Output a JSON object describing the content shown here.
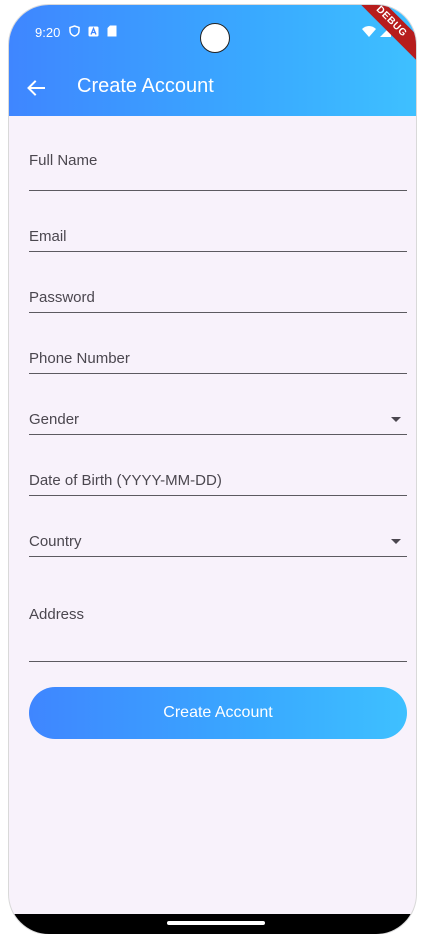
{
  "status_bar": {
    "time": "9:20",
    "icons": [
      "shield-icon",
      "a-icon",
      "sd-card-icon",
      "wifi-icon",
      "signal-icon",
      "battery-icon"
    ],
    "debug_label": "DEBUG"
  },
  "app_bar": {
    "title": "Create Account",
    "back_icon": "arrow-back-icon"
  },
  "form": {
    "fields": [
      {
        "label": "Full Name",
        "type": "text"
      },
      {
        "label": "Email",
        "type": "text"
      },
      {
        "label": "Password",
        "type": "password"
      },
      {
        "label": "Phone Number",
        "type": "text"
      },
      {
        "label": "Gender",
        "type": "dropdown"
      },
      {
        "label": "Date of Birth (YYYY-MM-DD)",
        "type": "text"
      },
      {
        "label": "Country",
        "type": "dropdown"
      },
      {
        "label": "Address",
        "type": "multiline"
      }
    ],
    "submit_label": "Create Account"
  },
  "colors": {
    "accent_start": "#3f86ff",
    "accent_end": "#3ec0ff",
    "background": "#f8f2fb",
    "debug_banner": "#b71c1c"
  }
}
